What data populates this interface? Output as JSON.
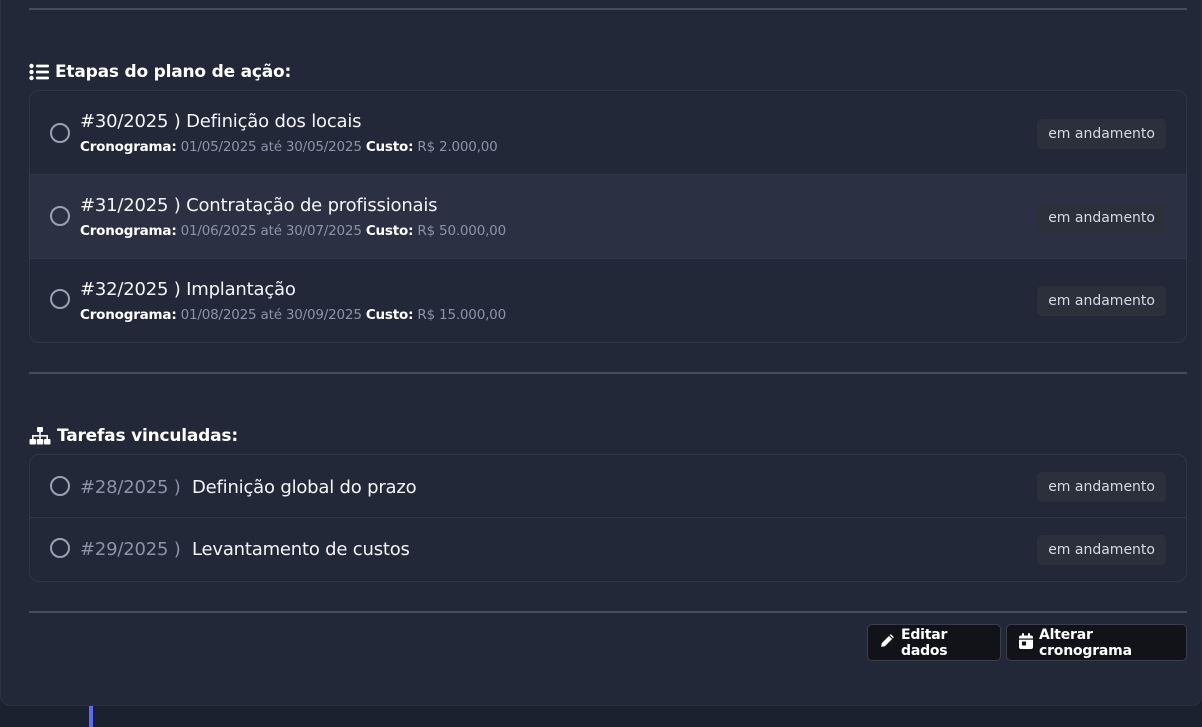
{
  "etapas": {
    "title": "Etapas do plano de ação:",
    "items": [
      {
        "title": "#30/2025 ) Definição dos locais",
        "cronograma_label": "Cronograma:",
        "cronograma_value": "01/05/2025 até 30/05/2025",
        "custo_label": "Custo:",
        "custo_value": "R$ 2.000,00",
        "status": "em andamento"
      },
      {
        "title": "#31/2025 ) Contratação de profissionais",
        "cronograma_label": "Cronograma:",
        "cronograma_value": "01/06/2025 até 30/07/2025",
        "custo_label": "Custo:",
        "custo_value": "R$ 50.000,00",
        "status": "em andamento"
      },
      {
        "title": "#32/2025 ) Implantação",
        "cronograma_label": "Cronograma:",
        "cronograma_value": "01/08/2025 até 30/09/2025",
        "custo_label": "Custo:",
        "custo_value": "R$ 15.000,00",
        "status": "em andamento"
      }
    ]
  },
  "tarefas": {
    "title": "Tarefas vinculadas:",
    "items": [
      {
        "number": "#28/2025 )",
        "name": "Definição global do prazo",
        "status": "em andamento"
      },
      {
        "number": "#29/2025 )",
        "name": "Levantamento de custos",
        "status": "em andamento"
      }
    ]
  },
  "actions": {
    "edit_label": "Editar dados",
    "schedule_label": "Alterar cronograma"
  },
  "icons": {
    "etapas": "list-icon",
    "tarefas": "sitemap-icon",
    "edit": "pencil-icon",
    "schedule": "calendar-icon",
    "status": "radio-circle-icon"
  },
  "colors": {
    "background": "#1c2130",
    "card": "#222838",
    "highlight_row": "#2b3142",
    "badge_bg": "#2c303b",
    "accent": "#5b6cf0",
    "muted_text": "#8a93a8"
  }
}
